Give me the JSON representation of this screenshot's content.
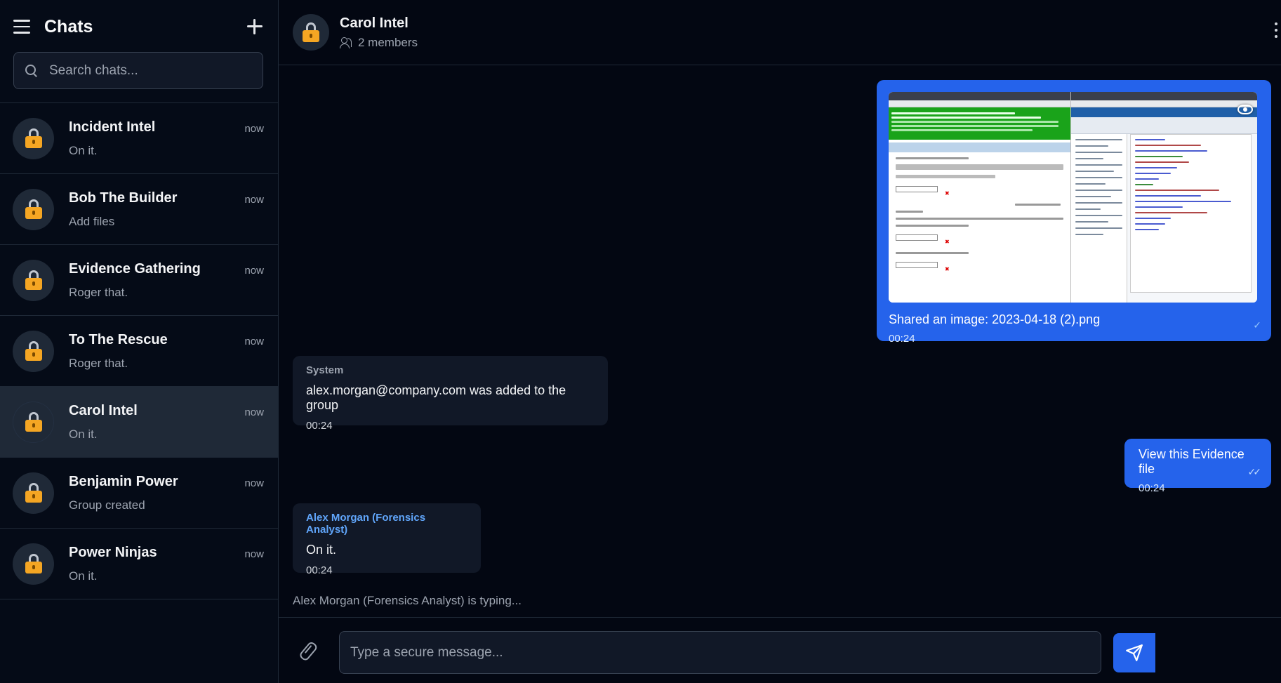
{
  "sidebar": {
    "title": "Chats",
    "search_placeholder": "Search chats...",
    "chats": [
      {
        "name": "Incident Intel",
        "preview": "On it.",
        "time": "now"
      },
      {
        "name": "Bob The Builder",
        "preview": "Add files",
        "time": "now"
      },
      {
        "name": "Evidence Gathering",
        "preview": "Roger that.",
        "time": "now"
      },
      {
        "name": "To The Rescue",
        "preview": "Roger that.",
        "time": "now"
      },
      {
        "name": "Carol Intel",
        "preview": "On it.",
        "time": "now",
        "active": true
      },
      {
        "name": "Benjamin Power",
        "preview": "Group created",
        "time": "now"
      },
      {
        "name": "Power Ninjas",
        "preview": "On it.",
        "time": "now"
      }
    ]
  },
  "header": {
    "title": "Carol Intel",
    "members": "2 members"
  },
  "messages": {
    "image": {
      "caption": "Shared an image: 2023-04-18 (2).png",
      "time": "00:24"
    },
    "system": {
      "sender": "System",
      "text": "alex.morgan@company.com was added to the group",
      "time": "00:24"
    },
    "view": {
      "text": "View this Evidence file",
      "time": "00:24"
    },
    "alex": {
      "sender": "Alex Morgan (Forensics Analyst)",
      "text": "On it.",
      "time": "00:24"
    }
  },
  "typing": "Alex Morgan (Forensics Analyst) is typing...",
  "composer": {
    "placeholder": "Type a secure message..."
  },
  "colors": {
    "accent": "#2563eb",
    "background": "#030712",
    "lock": "#f5a623",
    "sender_blue": "#60a5fa"
  },
  "icons": {
    "menu": "hamburger-icon",
    "new": "plus-icon",
    "search": "search-icon",
    "lock": "lock-icon",
    "members": "users-icon",
    "more": "kebab-icon",
    "attach": "paperclip-icon",
    "send": "send-icon",
    "preview": "eye-icon"
  }
}
